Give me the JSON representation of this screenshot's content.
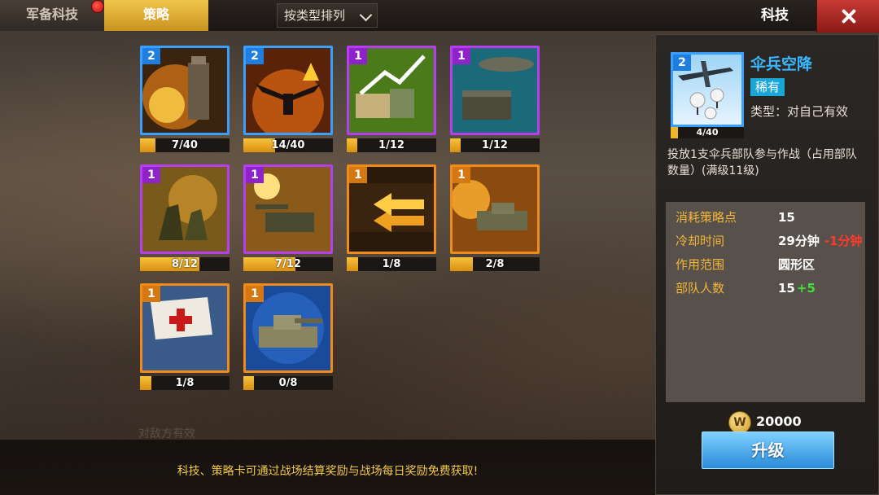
{
  "header": {
    "tab_tech": "军备科技",
    "tab_strategy": "策略",
    "sort_label": "按类型排列",
    "title": "科技"
  },
  "cards": [
    {
      "level": "2",
      "rarity": "blue",
      "progress_text": "7/40",
      "progress": 0.175,
      "art": "fortress-fire"
    },
    {
      "level": "2",
      "rarity": "blue",
      "progress_text": "14/40",
      "progress": 0.35,
      "art": "eagle-emblem"
    },
    {
      "level": "1",
      "rarity": "purple",
      "progress_text": "1/12",
      "progress": 0.083,
      "art": "supplies-arrow"
    },
    {
      "level": "1",
      "rarity": "purple",
      "progress_text": "1/12",
      "progress": 0.083,
      "art": "airdrop-crates"
    },
    {
      "level": "1",
      "rarity": "purple",
      "progress_text": "8/12",
      "progress": 0.667,
      "art": "soldiers"
    },
    {
      "level": "1",
      "rarity": "purple",
      "progress_text": "7/12",
      "progress": 0.583,
      "art": "artillery-tank"
    },
    {
      "level": "1",
      "rarity": "orange",
      "progress_text": "1/8",
      "progress": 0.125,
      "art": "tank-arrows"
    },
    {
      "level": "1",
      "rarity": "orange",
      "progress_text": "2/8",
      "progress": 0.25,
      "art": "tank-battle"
    },
    {
      "level": "1",
      "rarity": "orange",
      "progress_text": "1/8",
      "progress": 0.125,
      "art": "medic-flag"
    },
    {
      "level": "1",
      "rarity": "orange",
      "progress_text": "0/8",
      "progress": 0.0,
      "art": "heavy-tank"
    }
  ],
  "faded_text": "对敌方有效",
  "bottom_text": "科技、策略卡可通过战场结算奖励与战场每日奖励免费获取!",
  "panel": {
    "level": "2",
    "progress_text": "4/40",
    "progress": 0.1,
    "name": "伞兵空降",
    "rarity": "稀有",
    "type": "类型：对自己有效",
    "description": "投放1支伞兵部队参与作战（占用部队数量）(满级11级)",
    "stats": [
      {
        "label": "消耗策略点",
        "value": "15",
        "extra": "",
        "extra_color": ""
      },
      {
        "label": "冷却时间",
        "value": "29分钟",
        "extra": "-1分钟",
        "extra_color": "red"
      },
      {
        "label": "作用范围",
        "value": "圆形区",
        "extra": "",
        "extra_color": ""
      },
      {
        "label": "部队人数",
        "value": "15",
        "extra": "+5",
        "extra_color": "green"
      }
    ],
    "cost_icon": "W",
    "cost": "20000",
    "upgrade_label": "升级"
  },
  "colors": {
    "rarity_blue": "#3aa0ff",
    "rarity_purple": "#b43ef0",
    "rarity_orange": "#f08a18",
    "accent_gold": "#f2b63a",
    "title_blue": "#39b8ff"
  }
}
